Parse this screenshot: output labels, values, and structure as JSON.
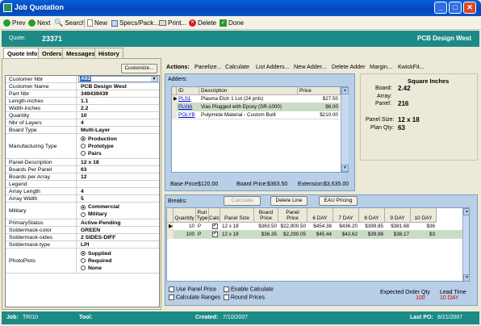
{
  "window": {
    "title": "Job Quotation"
  },
  "toolbar": {
    "prev": "Prev",
    "next": "Next",
    "search": "Search",
    "new": "New",
    "specs": "Specs/Pack...",
    "print": "Print...",
    "delete": "Delete",
    "done": "Done"
  },
  "header": {
    "quote_label": "Quote:",
    "quote_number": "23371",
    "company": "PCB Design West"
  },
  "tabs": [
    "Quote Info",
    "Orders",
    "Messages",
    "History"
  ],
  "customize_label": "Customize...",
  "fields": [
    {
      "k": "Customer Nbr",
      "v": "A02"
    },
    {
      "k": "Customer Name",
      "v": "PCB Design West"
    },
    {
      "k": "Part Nbr",
      "v": "349439439"
    },
    {
      "k": "Length-inches",
      "v": "1.1"
    },
    {
      "k": "Width-inches",
      "v": "2.2"
    },
    {
      "k": "Quantity",
      "v": "10"
    },
    {
      "k": "Nbr of Layers",
      "v": "4"
    },
    {
      "k": "Board Type",
      "v": "Multi-Layer"
    },
    {
      "k": "Manufacturing Type",
      "v": ""
    },
    {
      "k": "Panel-Description",
      "v": "12 x 18"
    },
    {
      "k": "Boards Per Panel",
      "v": "63"
    },
    {
      "k": "Boards per Array",
      "v": "12"
    },
    {
      "k": "Legend",
      "v": ""
    },
    {
      "k": "Array Length",
      "v": "4"
    },
    {
      "k": "Array Width",
      "v": "5"
    },
    {
      "k": "Military",
      "v": ""
    },
    {
      "k": "PrimaryStatus",
      "v": "Active-Pending"
    },
    {
      "k": "Soldermask-color",
      "v": "GREEN"
    },
    {
      "k": "Soldermask-sides",
      "v": "2 SIDES-DIFF"
    },
    {
      "k": "Soldermask-type",
      "v": "LPI"
    },
    {
      "k": "PhotoPlots",
      "v": ""
    }
  ],
  "mfg_options": [
    "Production",
    "Prototype",
    "Pairs"
  ],
  "military_options": [
    "Commercial",
    "Military"
  ],
  "photoplot_options": [
    "Supplied",
    "Required",
    "None"
  ],
  "actions": {
    "label": "Actions:",
    "items": [
      "Panelize...",
      "Calculate",
      "List Adders...",
      "New Adder...",
      "Delete Adder",
      "Margin...",
      "KwickFit..."
    ]
  },
  "adders": {
    "title": "Adders:",
    "columns": [
      "ID",
      "Description",
      "Price"
    ],
    "rows": [
      {
        "id": "PLS1",
        "desc": "Plasma Etch 1 Lot (24 pnls)",
        "price": "$27.50"
      },
      {
        "id": "PLVIA",
        "desc": "Vias Plugged with Epoxy (SR-1000)",
        "price": "$6.00"
      },
      {
        "id": "POLYB",
        "desc": "Polyimide Material - Custom Built",
        "price": "$210.00"
      }
    ],
    "base_price_label": "Base Price:",
    "base_price": "$120.00",
    "board_price_label": "Board Price:",
    "board_price": "$363.50",
    "extension_label": "Extension:",
    "extension": "$3,635.00"
  },
  "info": {
    "sq_label": "Square Inches",
    "board_label": "Board:",
    "board": "2.42",
    "array_label": "Array:",
    "array": "",
    "panel_label": "Panel:",
    "panel": "216",
    "panel_size_label": "Panel Size:",
    "panel_size": "12 x 18",
    "plan_qty_label": "Plan Qty:",
    "plan_qty": "63"
  },
  "breaks": {
    "title": "Breaks:",
    "calculate": "Calculate",
    "delete_line": "Delete Line",
    "eau": "EAU Pricing",
    "columns": [
      "Quantity",
      "Run Type",
      "Calc",
      "Panel Size",
      "Board Price",
      "Panel Price",
      "6 DAY",
      "7 DAY",
      "8 DAY",
      "9 DAY",
      "10 DAY"
    ],
    "rows": [
      [
        "10",
        "P",
        "",
        "12 x 18",
        "$363.50",
        "$22,900.50",
        "$454.38",
        "$436.20",
        "$399.85",
        "$381.68",
        "$36"
      ],
      [
        "100",
        "P",
        "",
        "12 x 18",
        "$36.35",
        "$2,290.05",
        "$45.44",
        "$43.62",
        "$39.98",
        "$38.17",
        "$3"
      ]
    ],
    "use_panel_price": "Use Panel Price",
    "calculate_ranges": "Calculate Ranges",
    "enable_calculate": "Enable Calculate",
    "round_prices": "Round Prices",
    "expected_label": "Expected Order Qty",
    "expected": "100",
    "lead_label": "Lead Time",
    "lead": "10 DAY"
  },
  "status": {
    "job_label": "Job:",
    "job": "TRI10",
    "tool_label": "Tool:",
    "tool": "",
    "created_label": "Created:",
    "created": "7/10/2007",
    "lastpo_label": "Last PO:",
    "lastpo": "8/21/2007"
  },
  "colors": {
    "header": "#1c8a86",
    "titlebar": "#0a5fd8",
    "panel": "#b8cfe8",
    "red": "#d00000"
  }
}
